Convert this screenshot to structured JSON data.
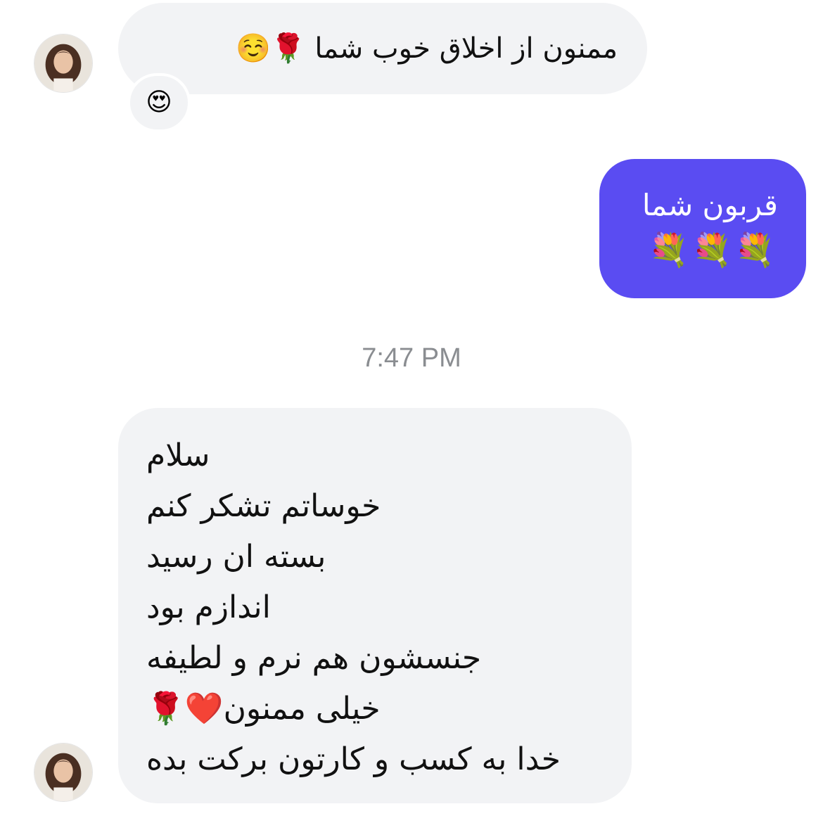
{
  "messages": [
    {
      "id": "msg1",
      "direction": "incoming",
      "text": "ممنون از اخلاق خوب شما",
      "emojis": "🌹☺️",
      "reaction": "😍"
    },
    {
      "id": "msg2",
      "direction": "outgoing",
      "line1": "قربون شما",
      "line2": "💐💐💐"
    },
    {
      "id": "msg3",
      "direction": "incoming",
      "lines": [
        "سلام",
        "خوساتم تشکر کنم",
        "بسته ان رسید",
        "اندازم بود",
        "جنسشون هم نرم و لطیفه",
        "خیلی ممنون❤️🌹",
        "خدا به کسب و کارتون برکت بده"
      ]
    }
  ],
  "timestamp": "7:47 PM",
  "colors": {
    "incoming_bubble": "#f2f3f5",
    "outgoing_bubble": "#5a4cf2",
    "timestamp": "#8a8d91"
  },
  "icons": {
    "avatar": "contact-avatar-photo"
  }
}
